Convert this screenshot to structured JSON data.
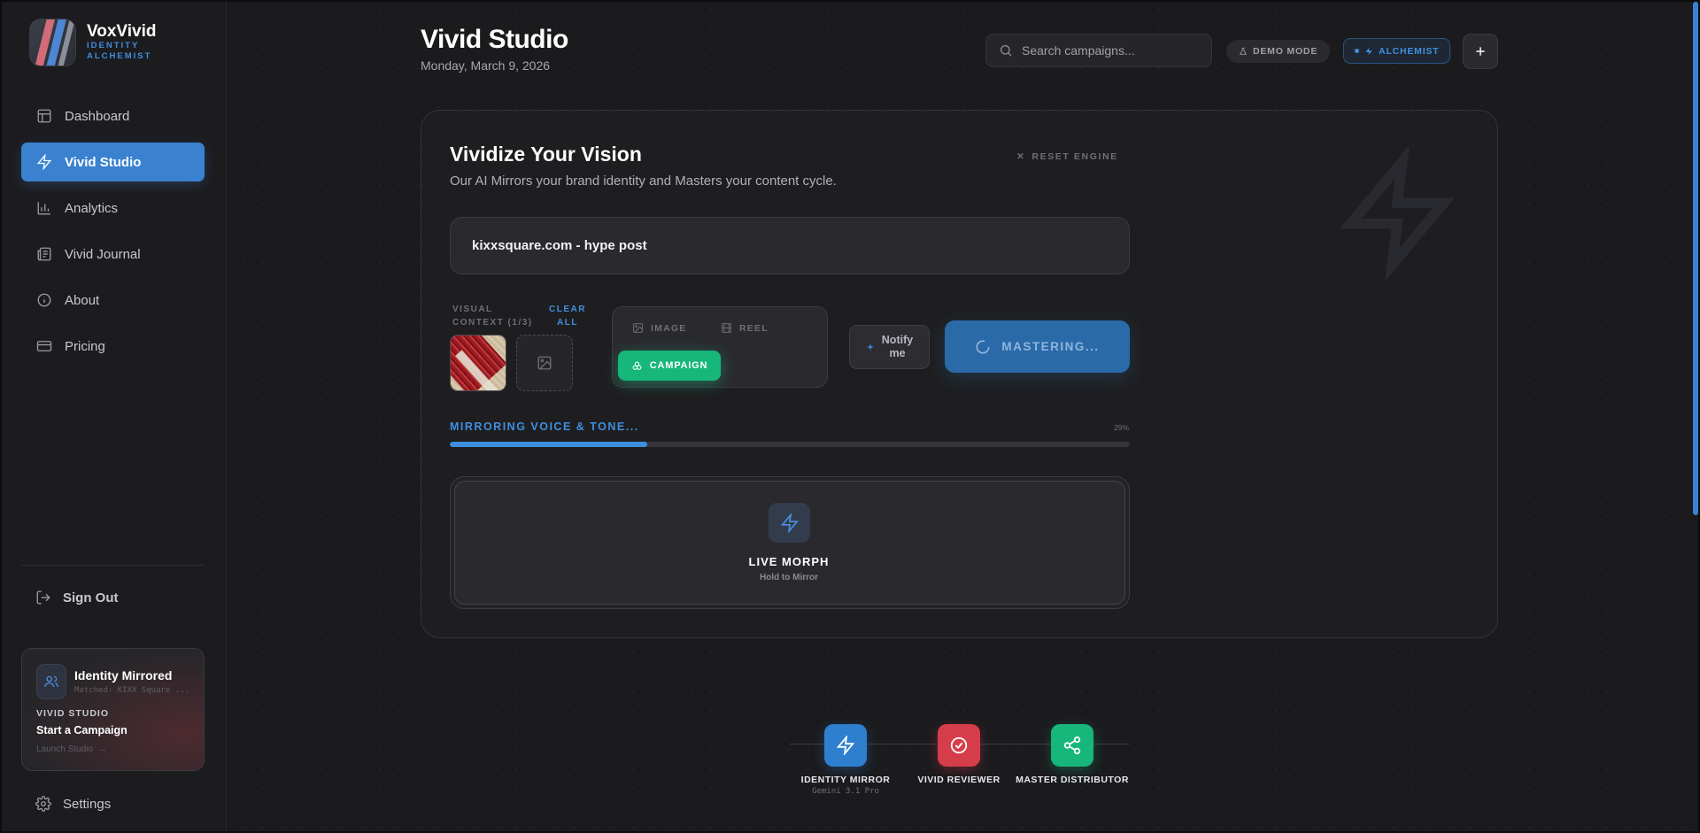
{
  "brand": {
    "name": "VoxVivid",
    "subtitle_line1": "IDENTITY",
    "subtitle_line2": "ALCHEMIST"
  },
  "sidebar": {
    "items": [
      {
        "label": "Dashboard",
        "icon": "layout-icon"
      },
      {
        "label": "Vivid Studio",
        "icon": "bolt-icon",
        "active": true
      },
      {
        "label": "Analytics",
        "icon": "bar-chart-icon"
      },
      {
        "label": "Vivid Journal",
        "icon": "newspaper-icon"
      },
      {
        "label": "About",
        "icon": "info-icon"
      },
      {
        "label": "Pricing",
        "icon": "credit-card-icon"
      }
    ],
    "sign_out": "Sign Out",
    "identity_card": {
      "title": "Identity Mirrored",
      "matched": "Matched: KIXX Square ...",
      "section": "VIVID STUDIO",
      "cta": "Start a Campaign",
      "launch": "Launch Studio"
    },
    "settings": "Settings"
  },
  "header": {
    "title": "Vivid Studio",
    "date": "Monday, March 9, 2026",
    "search_placeholder": "Search campaigns...",
    "demo_mode": "DEMO MODE",
    "plan_badge": "ALCHEMIST"
  },
  "studio": {
    "title": "Vividize Your Vision",
    "subtitle": "Our AI Mirrors your brand identity and Masters your content cycle.",
    "reset": "RESET ENGINE",
    "prompt_value": "kixxsquare.com - hype post",
    "visual_context_line1": "VISUAL",
    "visual_context_line2": "CONTEXT (1/3)",
    "clear_line1": "CLEAR",
    "clear_line2": "ALL",
    "types": {
      "image": "IMAGE",
      "reel": "REEL",
      "campaign": "CAMPAIGN",
      "selected": "campaign"
    },
    "notify_line1": "Notify",
    "notify_line2": "me",
    "master_button": "MASTERING...",
    "progress": {
      "label": "MIRRORING VOICE & TONE...",
      "percent_text": "29%",
      "value": 0.29
    },
    "live_morph": {
      "title": "LIVE MORPH",
      "subtitle": "Hold to Mirror"
    }
  },
  "pipeline": [
    {
      "label": "IDENTITY MIRROR",
      "model": "Gemini 3.1 Pro",
      "color": "#2f7fcf",
      "icon": "bolt-icon"
    },
    {
      "label": "VIVID REVIEWER",
      "model": "",
      "color": "#d63d4a",
      "icon": "check-circle-icon"
    },
    {
      "label": "MASTER DISTRIBUTOR",
      "model": "",
      "color": "#17b67a",
      "icon": "share-icon"
    }
  ],
  "colors": {
    "accent": "#3a82d0",
    "campaign": "#17b67a",
    "background": "#1b1b1e"
  }
}
